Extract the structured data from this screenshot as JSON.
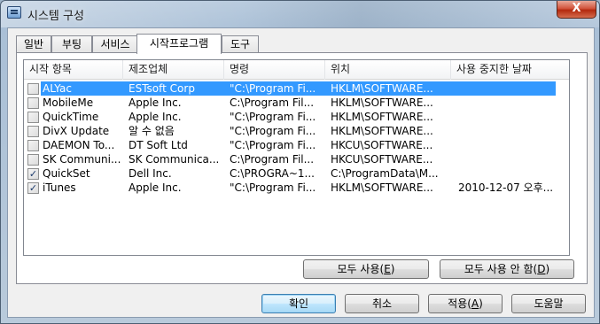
{
  "window": {
    "title": "시스템 구성",
    "close_label": "X"
  },
  "tabs": [
    {
      "label": "일반"
    },
    {
      "label": "부팅"
    },
    {
      "label": "서비스"
    },
    {
      "label": "시작프로그램",
      "active": true
    },
    {
      "label": "도구"
    }
  ],
  "columns": [
    "시작 항목",
    "제조업체",
    "명령",
    "위치",
    "사용 중지한 날짜"
  ],
  "rows": [
    {
      "checked": false,
      "selected": true,
      "item": "ALYac",
      "maker": "ESTsoft Corp",
      "command": "\"C:\\Program Fi...",
      "location": "HKLM\\SOFTWARE...",
      "date": ""
    },
    {
      "checked": false,
      "selected": false,
      "item": "MobileMe",
      "maker": "Apple Inc.",
      "command": "C:\\Program Fil...",
      "location": "HKLM\\SOFTWARE...",
      "date": ""
    },
    {
      "checked": false,
      "selected": false,
      "item": "QuickTime",
      "maker": "Apple Inc.",
      "command": "\"C:\\Program Fi...",
      "location": "HKLM\\SOFTWARE...",
      "date": ""
    },
    {
      "checked": false,
      "selected": false,
      "item": "DivX Update",
      "maker": "알 수 없음",
      "command": "\"C:\\Program Fi...",
      "location": "HKLM\\SOFTWARE...",
      "date": ""
    },
    {
      "checked": false,
      "selected": false,
      "item": "DAEMON To...",
      "maker": "DT Soft Ltd",
      "command": "\"C:\\Program Fi...",
      "location": "HKCU\\SOFTWARE...",
      "date": ""
    },
    {
      "checked": false,
      "selected": false,
      "item": "SK Communi...",
      "maker": "SK Communica...",
      "command": "C:\\Program Fil...",
      "location": "HKCU\\SOFTWARE...",
      "date": ""
    },
    {
      "checked": true,
      "selected": false,
      "item": "QuickSet",
      "maker": "Dell Inc.",
      "command": "C:\\PROGRA~1...",
      "location": "C:\\ProgramData\\M...",
      "date": ""
    },
    {
      "checked": true,
      "selected": false,
      "item": "iTunes",
      "maker": "Apple Inc.",
      "command": "\"C:\\Program Fi...",
      "location": "HKLM\\SOFTWARE...",
      "date": "2010-12-07 오후..."
    }
  ],
  "buttons": {
    "enable_all": {
      "text": "모두 사용(",
      "key": "E",
      "end": ")"
    },
    "disable_all": {
      "text": "모두 사용 안 함(",
      "key": "D",
      "end": ")"
    },
    "ok": "확인",
    "cancel": "취소",
    "apply": {
      "text": "적용(",
      "key": "A",
      "end": ")"
    },
    "help": "도움말"
  },
  "colors": {
    "selection": "#3399ff",
    "default_button_border": "#3c7fb1",
    "close_button": "#c8452a"
  }
}
